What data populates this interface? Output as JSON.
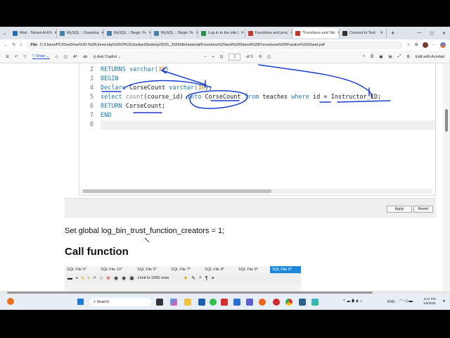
{
  "browser": {
    "tabs": [
      {
        "label": "Mail - Tahani Al-Kh",
        "color": "#2b6cb0"
      },
      {
        "label": "MySQL :: Downloa",
        "color": "#4a7fa8"
      },
      {
        "label": "MySQL :: Begin Yo",
        "color": "#4a7fa8"
      },
      {
        "label": "MySQL :: Begin Yo",
        "color": "#4a7fa8"
      },
      {
        "label": "Log in to the site |",
        "color": "#2e8b57"
      },
      {
        "label": "Functions and proc",
        "color": "#c0392b"
      },
      {
        "label": "*Functions and Sto",
        "color": "#c0392b",
        "active": true
      },
      {
        "label": "Convert to Text",
        "color": "#333"
      }
    ],
    "url_prefix": "File",
    "url": "C:/Users/PC/OneDrive%20-%20University%20Of%20Jordan/Desktop/2025_2026/db/material/Functions%20and%20Stored%20Procedures%20Practice%20Sheet.pdf"
  },
  "pdf_toolbar": {
    "draw": "Draw",
    "ask_copilot": "Ask Copilot",
    "zoom_minus": "−",
    "zoom_plus": "+",
    "page_current": "1",
    "page_total": "of 3",
    "edit_acrobat": "Edit with Acrobat"
  },
  "editor": {
    "line_numbers": [
      "2",
      "3",
      "4",
      "5",
      "6",
      "7",
      "8"
    ]
  },
  "code": {
    "l2a": "RETURNS varchar(",
    "l2b": "30",
    "l2c": ")",
    "l3": "BEGIN",
    "l4a": "Declare",
    "l4b": " CorseCount ",
    "l4c": "varchar(",
    "l4d": "30",
    "l4e": ");",
    "l5a": "select ",
    "l5b": "count",
    "l5c": "(course_id) ",
    "l5d": "into",
    "l5e": " CorseCount ",
    "l5f": "from",
    "l5g": " teaches ",
    "l5h": "where",
    "l5i": " id = Instructor_ID;",
    "l6a": "RETURN",
    "l6b": " CorseCount;",
    "l7": "END"
  },
  "panel": {
    "apply": "Apply",
    "revert": "Revert"
  },
  "document": {
    "set_global": "Set global log_bin_trust_function_creators = 1;",
    "heading": "Call function"
  },
  "workbench": {
    "tabs": [
      "SQL File 5*",
      "SQL File 10*",
      "SQL File 6*",
      "SQL File 7*",
      "SQL File 8*",
      "SQL File 9*",
      "SQL File 9*"
    ],
    "limit": "Limit to 1000 rows"
  },
  "taskbar": {
    "search": "Search",
    "lang": "ENG",
    "time": "3:21 PM",
    "date": "1/6/2026"
  },
  "colors": {
    "annotation": "#1a3fd0",
    "accent": "#1e7ab5"
  }
}
